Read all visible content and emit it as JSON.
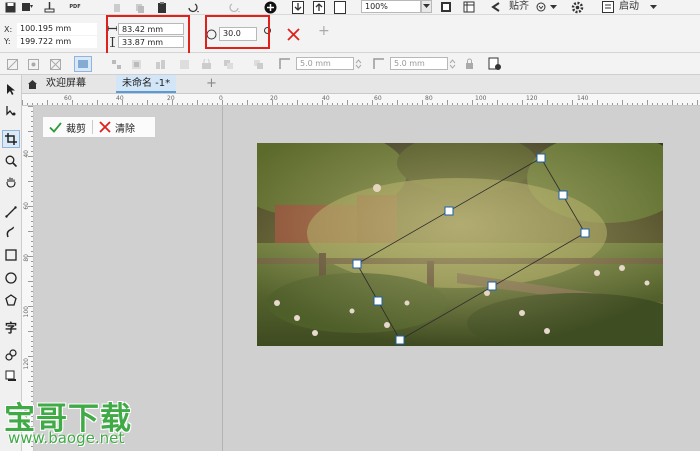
{
  "toolbar_top": {
    "zoom_value": "100%",
    "snap_label": "贴齐",
    "launch_label": "启动",
    "pdf_label": "PDF"
  },
  "propbar": {
    "x_label": "X:",
    "x_value": "100.195 mm",
    "y_label": "Y:",
    "y_value": "199.722 mm",
    "width_value": "83.42 mm",
    "height_value": "33.87 mm",
    "rotation_value": "30.0",
    "add_symbol": "+"
  },
  "toolbar3": {
    "outline_width_1": "5.0 mm",
    "outline_width_2": "5.0 mm"
  },
  "tabs": {
    "welcome_label": "欢迎屏幕",
    "document_label": "未命名 -1*",
    "add_label": "+"
  },
  "hruler": {
    "labels": [
      "60",
      "40",
      "20",
      "0",
      "20",
      "40",
      "60",
      "80",
      "100",
      "120",
      "140"
    ]
  },
  "vruler": {
    "labels": [
      "40",
      "60",
      "80",
      "100",
      "120",
      "140"
    ]
  },
  "crop_bar": {
    "crop_label": "裁剪",
    "clear_label": "清除"
  },
  "toolbox": {
    "text_tool_label": "字"
  },
  "watermark": {
    "brand": "宝哥下载",
    "url": "www.baoge.net"
  },
  "colors": {
    "highlight_red": "#e0201a",
    "confirm_green": "#2e9a3a",
    "watermark_green": "#3faa46"
  }
}
